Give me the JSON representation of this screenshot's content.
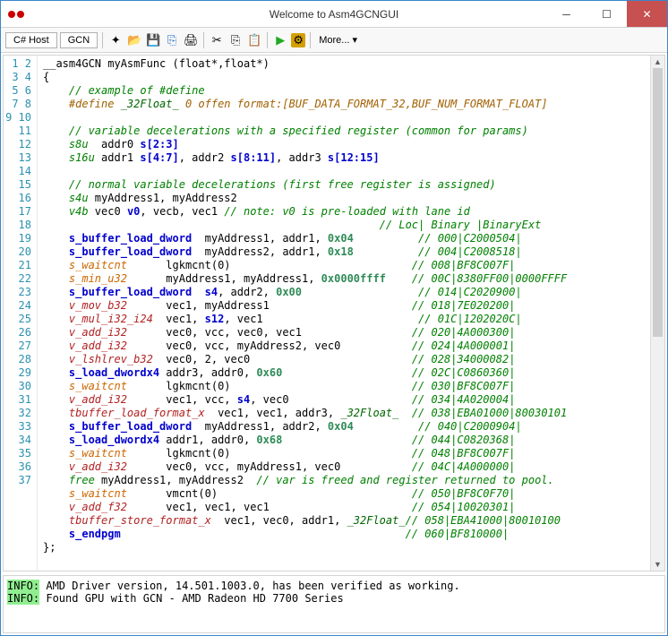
{
  "window": {
    "title": "Welcome to Asm4GCNGUI"
  },
  "tabs": {
    "t1": "C# Host",
    "t2": "GCN"
  },
  "more": "More...",
  "lines": [
    "1",
    "2",
    "3",
    "4",
    "5",
    "6",
    "7",
    "8",
    "9",
    "10",
    "11",
    "12",
    "13",
    "14",
    "15",
    "16",
    "17",
    "18",
    "19",
    "20",
    "21",
    "22",
    "23",
    "24",
    "25",
    "26",
    "27",
    "28",
    "29",
    "30",
    "31",
    "32",
    "33",
    "34",
    "35",
    "36",
    "37"
  ],
  "code": {
    "l1_a": "__asm4GCN myAsmFunc (float*,float*)",
    "l2": "{",
    "l3": "    // example of #define",
    "l4a": "    #define ",
    "l4b": "_32Float_",
    "l4c": " 0 offen format:[BUF_DATA_FORMAT_32,BUF_NUM_FORMAT_FLOAT]",
    "l6": "    // variable decelerations with a specified register (common for params)",
    "l7a": "    s8u",
    "l7b": "  addr0 ",
    "l7c": "s[2:3]",
    "l8a": "    s16u",
    "l8b": " addr1 ",
    "l8c": "s[4:7]",
    "l8d": ", addr2 ",
    "l8e": "s[8:11]",
    "l8f": ", addr3 ",
    "l8g": "s[12:15]",
    "l10": "    // normal variable decelerations (first free register is assigned)",
    "l11a": "    s4u",
    "l11b": " myAddress1, myAddress2",
    "l12a": "    v4b",
    "l12b": " vec0 ",
    "l12c": "v0",
    "l12d": ", vecb, vec1 ",
    "l12e": "// note: v0 is pre-loaded with lane id",
    "l13c": "                                                    // Loc| Binary |BinaryExt",
    "l14a": "    s_buffer_load_dword",
    "l14b": "  myAddress1, addr1, ",
    "l14c": "0x04",
    "l14d": "          // 000|C2000504|",
    "l15a": "    s_buffer_load_dword",
    "l15b": "  myAddress2, addr1, ",
    "l15c": "0x18",
    "l15d": "          // 004|C2008518|",
    "l16a": "    s_waitcnt",
    "l16b": "      lgkmcnt(0)",
    "l16c": "                            // 008|BF8C007F|",
    "l17a": "    s_min_u32",
    "l17b": "      myAddress1, myAddress1, ",
    "l17c": "0x0000ffff",
    "l17d": "    // 00C|8380FF00|0000FFFF",
    "l18a": "    s_buffer_load_dword",
    "l18b": "  ",
    "l18c": "s4",
    "l18d": ", addr2, ",
    "l18e": "0x00",
    "l18f": "                  // 014|C2020900|",
    "l19a": "    v_mov_b32",
    "l19b": "      vec1, myAddress1",
    "l19c": "                      // 018|7E020200|",
    "l20a": "    v_mul_i32_i24",
    "l20b": "  vec1, ",
    "l20c": "s12",
    "l20d": ", vec1",
    "l20e": "                        // 01C|1202020C|",
    "l21a": "    v_add_i32",
    "l21b": "      vec0, vcc, vec0, vec1",
    "l21c": "                 // 020|4A000300|",
    "l22a": "    v_add_i32",
    "l22b": "      vec0, vcc, myAddress2, vec0",
    "l22c": "           // 024|4A000001|",
    "l23a": "    v_lshlrev_b32",
    "l23b": "  vec0, 2, vec0",
    "l23c": "                         // 028|34000082|",
    "l24a": "    s_load_dwordx4",
    "l24b": " addr3, addr0, ",
    "l24c": "0x60",
    "l24d": "                    // 02C|C0860360|",
    "l25a": "    s_waitcnt",
    "l25b": "      lgkmcnt(0)",
    "l25c": "                            // 030|BF8C007F|",
    "l26a": "    v_add_i32",
    "l26b": "      vec1, vcc, ",
    "l26c": "s4",
    "l26d": ", vec0",
    "l26e": "                   // 034|4A020004|",
    "l27a": "    tbuffer_load_format_x",
    "l27b": "  vec1, vec1, addr3, ",
    "l27c": "_32Float_",
    "l27d": "  // 038|EBA01000|80030101",
    "l28a": "    s_buffer_load_dword",
    "l28b": "  myAddress1, addr2, ",
    "l28c": "0x04",
    "l28d": "          // 040|C2000904|",
    "l29a": "    s_load_dwordx4",
    "l29b": " addr1, addr0, ",
    "l29c": "0x68",
    "l29d": "                    // 044|C0820368|",
    "l30a": "    s_waitcnt",
    "l30b": "      lgkmcnt(0)",
    "l30c": "                            // 048|BF8C007F|",
    "l31a": "    v_add_i32",
    "l31b": "      vec0, vcc, myAddress1, vec0",
    "l31c": "           // 04C|4A000000|",
    "l32a": "    free",
    "l32b": " myAddress1, myAddress2  ",
    "l32c": "// var is freed and register returned to pool.",
    "l33a": "    s_waitcnt",
    "l33b": "      vmcnt(0)",
    "l33c": "                              // 050|BF8C0F70|",
    "l34a": "    v_add_f32",
    "l34b": "      vec1, vec1, vec1",
    "l34c": "                      // 054|10020301|",
    "l35a": "    tbuffer_store_format_x",
    "l35b": "  vec1, vec0, addr1, ",
    "l35c": "_32Float_",
    "l35d": "// 058|EBA41000|80010100",
    "l36a": "    s_endpgm",
    "l36b": "                                            // 060|BF810000|",
    "l37": "};"
  },
  "output": {
    "info": "INFO:",
    "line1": " AMD Driver version, 14.501.1003.0, has been verified as working.",
    "line2": " Found GPU with GCN - AMD Radeon HD 7700 Series"
  }
}
